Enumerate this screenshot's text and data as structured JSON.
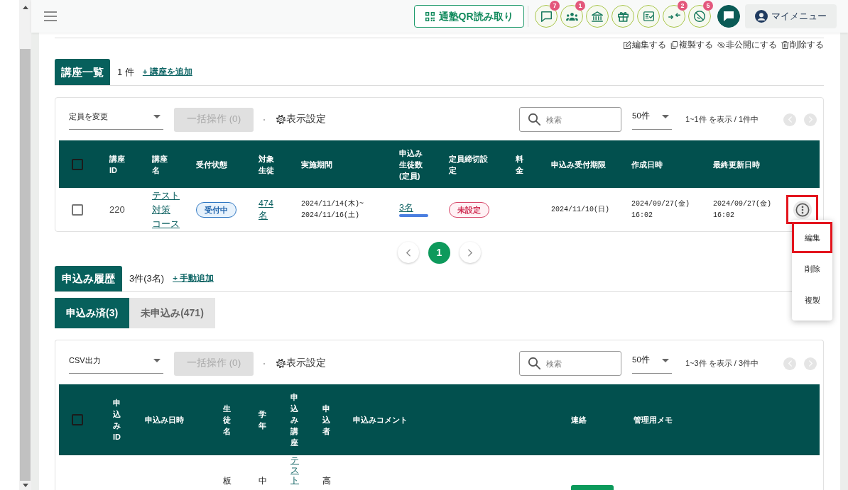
{
  "top_bar": {
    "qr_button": "通塾QR読み取り",
    "icon_buttons": [
      {
        "kind": "chat",
        "badge": "7"
      },
      {
        "kind": "people",
        "badge": "1"
      },
      {
        "kind": "school"
      },
      {
        "kind": "gift"
      },
      {
        "kind": "checklist"
      },
      {
        "kind": "merge",
        "badge": "2"
      },
      {
        "kind": "blocked",
        "badge": "5"
      },
      {
        "kind": "message"
      }
    ],
    "my_menu": "マイメニュー"
  },
  "item_actions": [
    {
      "kind": "edit",
      "label": "編集する"
    },
    {
      "kind": "copy",
      "label": "複製する"
    },
    {
      "kind": "hide",
      "label": "非公開にする"
    },
    {
      "kind": "delete",
      "label": "削除する"
    }
  ],
  "courses": {
    "title": "講座一覧",
    "count": "1 件",
    "add_link": "+ 講座を追加",
    "toolbar": {
      "select": "定員を変更",
      "bulk_button": {
        "label": "一括操作 (0)",
        "disabled": true
      },
      "display_settings": "表示設定",
      "search_placeholder": "検索",
      "page_size": "50件",
      "range": "1~1件 を表示 / 1件中",
      "prev_disabled": true,
      "next_disabled": true
    },
    "table": {
      "header_checked": false,
      "columns": [
        "講座ID",
        "講座名",
        "受付状態",
        "対象生徒",
        "実施期間",
        "申込み生徒数(定員)",
        "定員締切設定",
        "料金",
        "申込み受付期限",
        "作成日時",
        "最終更新日時"
      ],
      "rows": [
        {
          "checked": false,
          "id": "220",
          "name": "テスト対策コース",
          "status": {
            "label": "受付中",
            "kind": "info"
          },
          "target": "474名",
          "period": "2024/11/14(木)~\n2024/11/16(土)",
          "applicants": "3名",
          "deadline_setting": {
            "label": "未設定",
            "kind": "alert"
          },
          "accept_until": "2024/11/10(日)",
          "created": "2024/09/27(金) 16:02",
          "updated": "2024/09/27(金) 16:02",
          "row_menu": {
            "highlighted": true,
            "expanded": true,
            "items": [
              {
                "label": "編集",
                "highlighted": true
              },
              {
                "label": "削除",
                "highlighted": false
              },
              {
                "label": "複製",
                "highlighted": false
              }
            ]
          }
        }
      ]
    },
    "pagination": [
      {
        "label": "1",
        "selected": true
      }
    ]
  },
  "applications": {
    "title": "申込み履歴",
    "count": "3件(3名)",
    "add_link": "+ 手動追加",
    "tabs": [
      {
        "label": "申込み済(3)",
        "selected": true
      },
      {
        "label": "未申込み(471)",
        "selected": false
      }
    ],
    "toolbar": {
      "select": "CSV出力",
      "bulk_button": {
        "label": "一括操作 (0)",
        "disabled": true
      },
      "display_settings": "表示設定",
      "search_placeholder": "検索",
      "page_size": "50件",
      "range": "1~3件 を表示 / 3件中",
      "prev_disabled": true,
      "next_disabled": true
    },
    "table": {
      "header_checked": false,
      "columns": [
        "申込みID",
        "申込み日時",
        "生徒名",
        "学年",
        "申込み講座",
        "申込者",
        "申込みコメント",
        "連絡",
        "管理用メモ"
      ],
      "rows": [
        {
          "student": "板",
          "grade": "中",
          "course": "テスト",
          "applicant": "高",
          "contact_button": true
        }
      ]
    }
  }
}
